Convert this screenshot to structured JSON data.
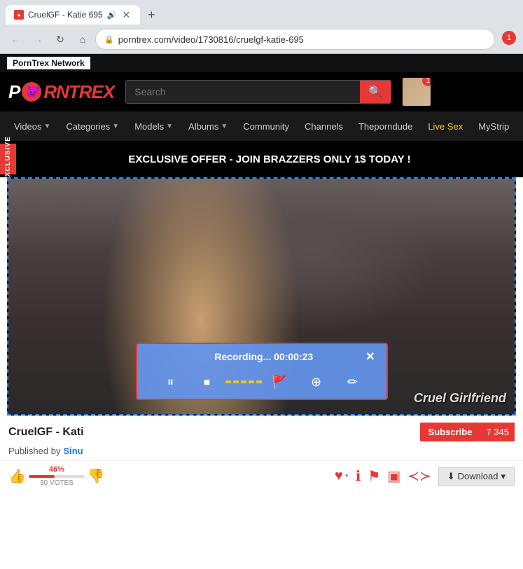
{
  "browser": {
    "tab_title": "CruelGF - Katie 695",
    "tab_favicon": "🔴",
    "url": "porntrex.com/video/1730816/cruelgf-katie-695",
    "new_tab_icon": "+",
    "back_icon": "←",
    "forward_icon": "→",
    "refresh_icon": "↻",
    "home_icon": "⌂",
    "lock_icon": "🔒",
    "menu_icon": "⋮",
    "notification_count": "1"
  },
  "site": {
    "network_label": "PornTrex Network",
    "logo_text_before": "P",
    "logo_devil": "😈",
    "logo_text_after": "RNTREX",
    "search_placeholder": "Search",
    "search_icon": "🔍"
  },
  "nav": {
    "items": [
      {
        "label": "Videos",
        "has_arrow": true
      },
      {
        "label": "Categories",
        "has_arrow": true
      },
      {
        "label": "Models",
        "has_arrow": true
      },
      {
        "label": "Albums",
        "has_arrow": true
      },
      {
        "label": "Community",
        "has_arrow": false
      },
      {
        "label": "Channels",
        "has_arrow": false
      },
      {
        "label": "Theporndude",
        "has_arrow": false
      },
      {
        "label": "Live Sex",
        "has_arrow": false,
        "highlight": true
      },
      {
        "label": "MyStrip",
        "has_arrow": false
      }
    ]
  },
  "promo": {
    "exclusive_label": "EXCLUSIVE",
    "text": "EXCLUSIVE OFFER - JOIN BRAZZERS ONLY 1$ TODAY !"
  },
  "video": {
    "watermark": "Cruel Girlfriend",
    "title": "CruelGF - Kati",
    "title_full": "CruelGF - Katie 695"
  },
  "recording": {
    "title": "Recording... 00:00:23",
    "close_icon": "✕",
    "pause_icon": "⏸",
    "stop_icon": "⏹",
    "marker_icon": "🚩",
    "camera_icon": "⊙",
    "edit_icon": "✏"
  },
  "video_info": {
    "title": "CruelGF - Kati",
    "published_prefix": "Published by",
    "published_by": "Sinu",
    "subscribe_label": "Subscribe",
    "subscribe_count": "7 345"
  },
  "actions": {
    "vote_percent": "46%",
    "vote_label": "30 VOTES",
    "vote_count": "(30 VOTES)",
    "heart_icon": "♥",
    "info_icon": "ℹ",
    "flag_icon": "⚑",
    "image_icon": "▣",
    "share_icon": "⋈",
    "download_label": "Download",
    "download_arrow": "▾"
  }
}
